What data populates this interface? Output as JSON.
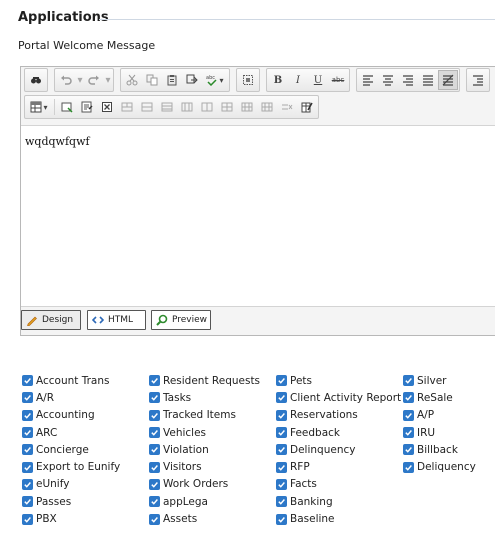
{
  "section": {
    "title": "Applications"
  },
  "field": {
    "label": "Portal Welcome Message"
  },
  "editor": {
    "content": "wqdqwfqwf",
    "modes": {
      "design": "Design",
      "html": "HTML",
      "preview": "Preview"
    },
    "format_labels": {
      "bold": "B",
      "italic": "I",
      "underline": "U",
      "strike": "abc"
    }
  },
  "modules": {
    "columns": [
      [
        "Account Trans",
        "A/R",
        "Accounting",
        "ARC",
        "Concierge",
        "Export to Eunify",
        "eUnify",
        "Passes",
        "PBX"
      ],
      [
        "Resident Requests",
        "Tasks",
        "Tracked Items",
        "Vehicles",
        "Violation",
        "Visitors",
        "Work Orders",
        "appLega",
        "Assets"
      ],
      [
        "Pets",
        "Client Activity Report",
        "Reservations",
        "Feedback",
        "Delinquency",
        "RFP",
        "Facts",
        "Banking",
        "Baseline"
      ],
      [
        "Silver",
        "ReSale",
        "A/P",
        "IRU",
        "Billback",
        "Deliquency"
      ]
    ],
    "checked": true,
    "check_color": "#2d78c8"
  },
  "icons": {
    "toolbar_row1": [
      "find-icon",
      "undo-icon",
      "redo-icon",
      "cut-icon",
      "copy-icon",
      "paste-icon",
      "paste-plain-icon",
      "spellcheck-icon",
      "select-all-icon",
      "bold-icon",
      "italic-icon",
      "underline-icon",
      "strikethrough-icon",
      "align-left-icon",
      "align-center-icon",
      "align-right-icon",
      "justify-icon",
      "remove-alignment-icon"
    ],
    "toolbar_row2": [
      "table-icon",
      "insert-row-icon",
      "insert-col-icon",
      "delete-cell-icon",
      "merge-cells-icon",
      "split-cells-icon"
    ]
  }
}
